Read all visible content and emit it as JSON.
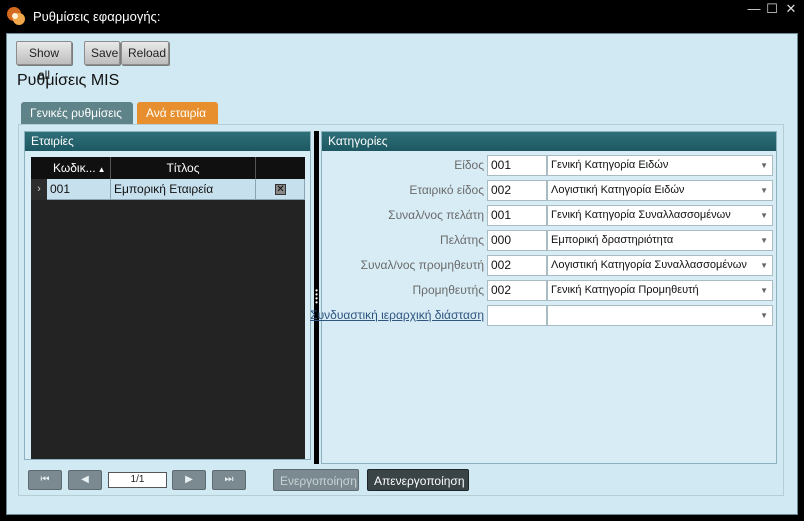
{
  "window": {
    "title": "Ρυθμίσεις εφαρμογής:",
    "controls": {
      "minimize": "—",
      "maximize": "☐",
      "close": "✕"
    }
  },
  "toolbar": {
    "show_all": "Show all",
    "save": "Save",
    "reload": "Reload"
  },
  "page_title": "Ρυθμίσεις MIS",
  "tabs": [
    {
      "label": "Γενικές ρυθμίσεις",
      "active": false
    },
    {
      "label": "Ανά εταιρία",
      "active": true
    }
  ],
  "companies_panel": {
    "header": "Εταιρίες",
    "columns": {
      "code": "Κωδικ...",
      "title": "Τίτλος"
    },
    "sort_indicator": "▲",
    "rows": [
      {
        "indicator": "›",
        "code": "001",
        "title": "Εμπορική Εταιρεία",
        "delete": "✕"
      }
    ]
  },
  "categories_panel": {
    "header": "Κατηγορίες",
    "fields": [
      {
        "label": "Είδος",
        "code": "001",
        "value": "Γενική Κατηγορία Ειδών"
      },
      {
        "label": "Εταιρικό είδος",
        "code": "002",
        "value": "Λογιστική Κατηγορία Ειδών"
      },
      {
        "label": "Συναλ/νος πελάτη",
        "code": "001",
        "value": "Γενική Κατηγορία Συναλλασσομένων"
      },
      {
        "label": "Πελάτης",
        "code": "000",
        "value": "Εμπορική δραστηριότητα"
      },
      {
        "label": "Συναλ/νος προμηθευτή",
        "code": "002",
        "value": "Λογιστική Κατηγορία Συναλλασσομένων"
      },
      {
        "label": "Προμηθευτής",
        "code": "002",
        "value": "Γενική Κατηγορία Προμηθευτή"
      },
      {
        "label": "Συνδυαστική ιεραρχική διάσταση",
        "code": "",
        "value": ""
      }
    ],
    "dropdown_arrow": "▼"
  },
  "navigation": {
    "first": "⏮",
    "prev": "◀",
    "page": "1/1",
    "next": "▶",
    "last": "⏭",
    "activate": "Ενεργοποίηση",
    "deactivate": "Απενεργοποίηση"
  },
  "colors": {
    "accent_tab": "#e78f2e",
    "panel_header": "#1d5862",
    "selected_row": "#c7e0ee",
    "background": "#d1e9f2"
  }
}
